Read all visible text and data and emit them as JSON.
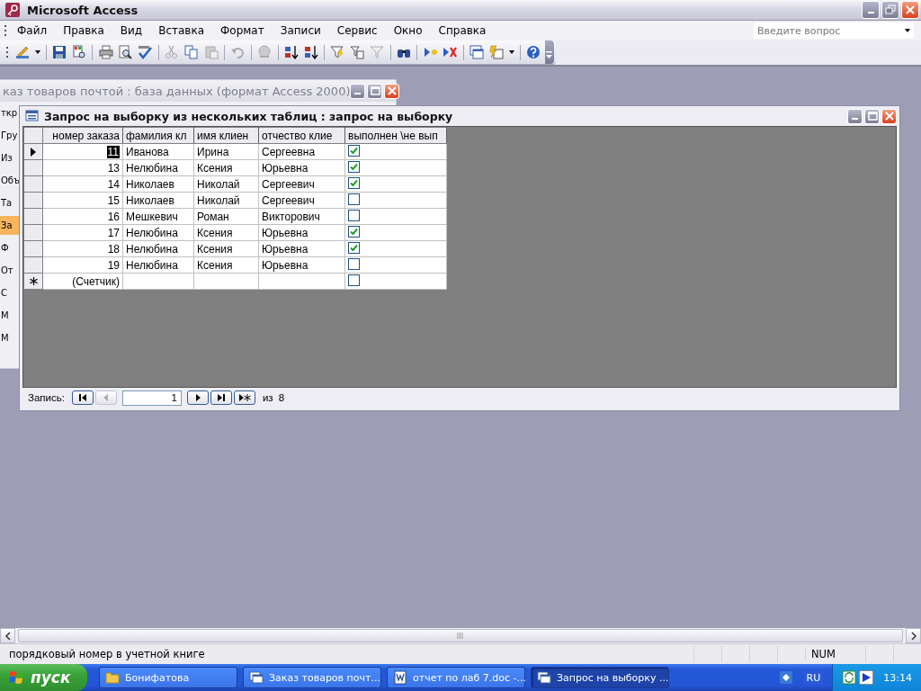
{
  "window": {
    "title": "Microsoft Access"
  },
  "menu": [
    {
      "label": "Файл"
    },
    {
      "label": "Правка"
    },
    {
      "label": "Вид"
    },
    {
      "label": "Вставка"
    },
    {
      "label": "Формат"
    },
    {
      "label": "Записи"
    },
    {
      "label": "Сервис"
    },
    {
      "label": "Окно"
    },
    {
      "label": "Справка"
    }
  ],
  "help_search": {
    "placeholder": "Введите вопрос"
  },
  "database_window": {
    "title": "каз товаров почтой : база данных (формат Access 2000)",
    "items": [
      {
        "label": "ткр",
        "selected": false
      },
      {
        "label": "Гру",
        "selected": false
      },
      {
        "label": "Из",
        "selected": false
      },
      {
        "label": "Объ",
        "selected": false
      },
      {
        "label": "Та",
        "selected": false
      },
      {
        "label": "За",
        "selected": true
      },
      {
        "label": "Ф",
        "selected": false
      },
      {
        "label": "От",
        "selected": false
      },
      {
        "label": "С",
        "selected": false
      },
      {
        "label": "М",
        "selected": false
      },
      {
        "label": "М",
        "selected": false
      }
    ]
  },
  "query_window": {
    "title": "Запрос на выборку из нескольких таблиц : запрос на выборку",
    "columns": [
      "номер заказа",
      "фамилия  кл",
      "имя  клиен",
      "отчество  клие",
      "выполнен \\не вып"
    ],
    "rows": [
      {
        "cells": [
          "11",
          "Иванова",
          "Ирина",
          "Сергеевна"
        ],
        "checked": true,
        "selected": true
      },
      {
        "cells": [
          "13",
          "Нелюбина",
          "Ксения",
          "Юрьевна"
        ],
        "checked": true,
        "selected": false
      },
      {
        "cells": [
          "14",
          "Николаев",
          "Николай",
          "Сергеевич"
        ],
        "checked": true,
        "selected": false
      },
      {
        "cells": [
          "15",
          "Николаев",
          "Николай",
          "Сергеевич"
        ],
        "checked": false,
        "selected": false
      },
      {
        "cells": [
          "16",
          "Мешкевич",
          "Роман",
          "Викторович"
        ],
        "checked": false,
        "selected": false
      },
      {
        "cells": [
          "17",
          "Нелюбина",
          "Ксения",
          "Юрьевна"
        ],
        "checked": true,
        "selected": false
      },
      {
        "cells": [
          "18",
          "Нелюбина",
          "Ксения",
          "Юрьевна"
        ],
        "checked": true,
        "selected": false
      },
      {
        "cells": [
          "19",
          "Нелюбина",
          "Ксения",
          "Юрьевна"
        ],
        "checked": false,
        "selected": false
      }
    ],
    "new_row": {
      "counter": "(Счетчик)",
      "checked": false
    },
    "navigation": {
      "label": "Запись:",
      "current": "1",
      "of": "из",
      "total": "8"
    }
  },
  "status_bar": {
    "text": "порядковый номер в учетной книге",
    "indicator": "NUM"
  },
  "taskbar": {
    "start": "пуск",
    "tasks": [
      {
        "label": "Бонифатова",
        "kind": "folder",
        "selected": false
      },
      {
        "label": "Заказ товаров почт...",
        "kind": "database",
        "selected": false
      },
      {
        "label": "отчет по лаб 7.doc -...",
        "kind": "document",
        "selected": false
      },
      {
        "label": "Запрос на выборку ...",
        "kind": "database",
        "selected": true
      }
    ],
    "language": "RU",
    "clock": "13:14"
  }
}
